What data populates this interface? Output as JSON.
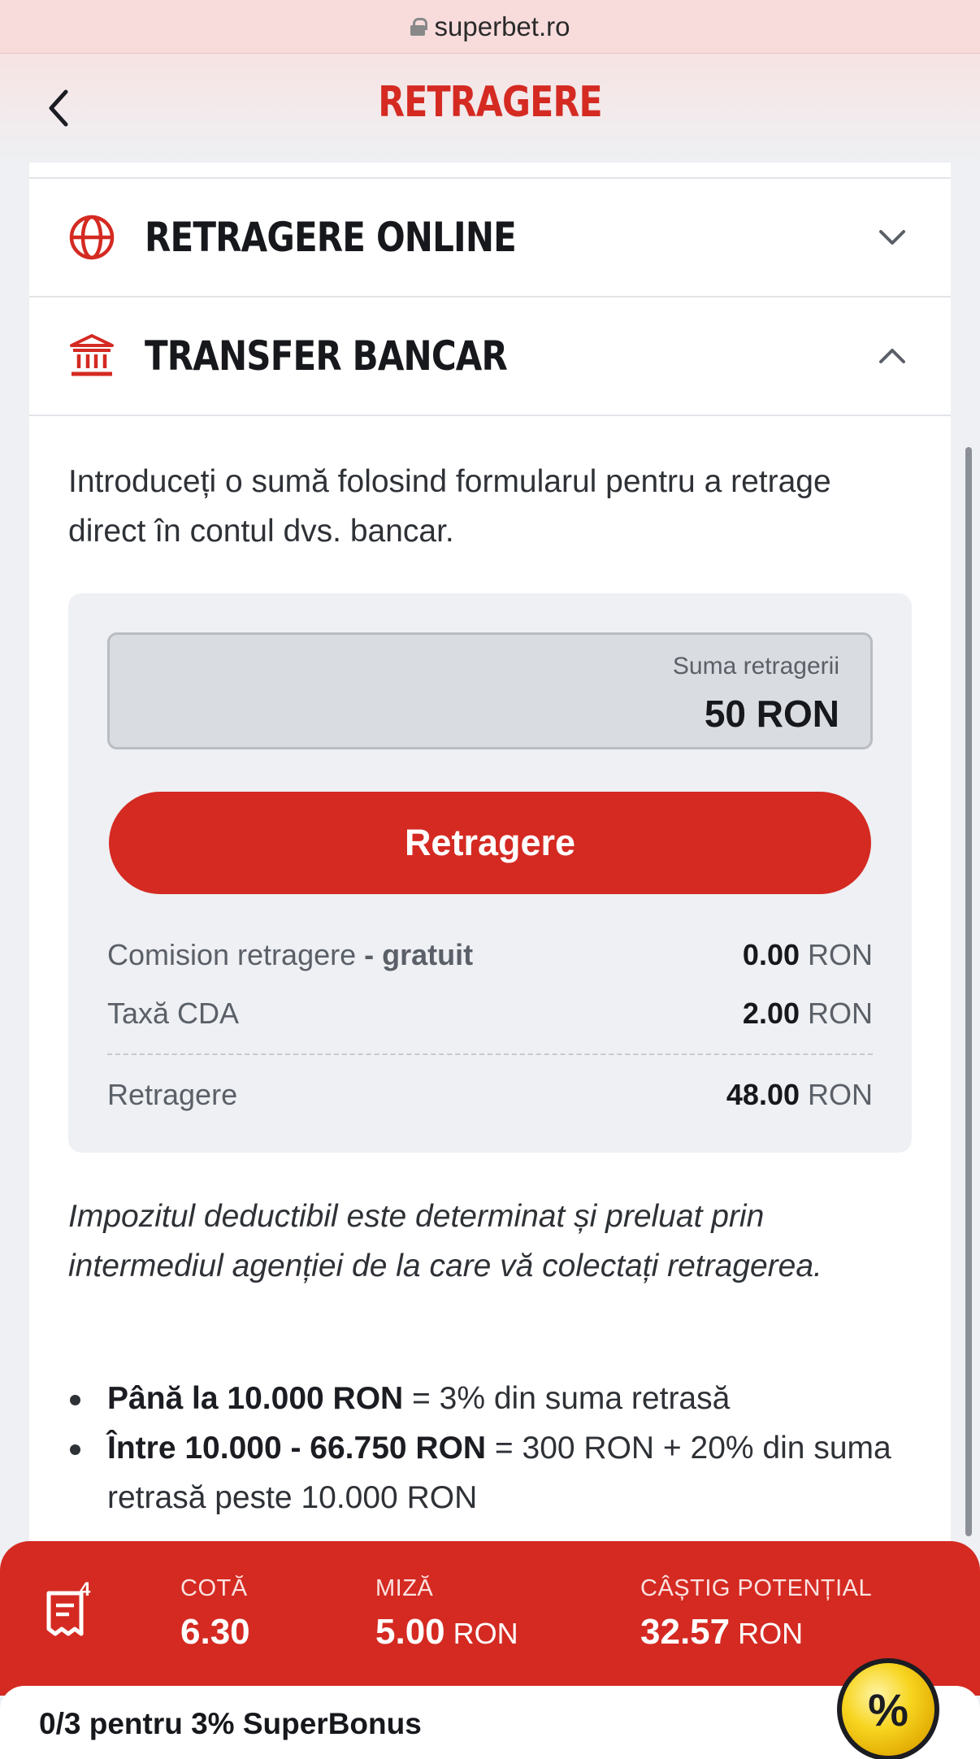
{
  "browser": {
    "url": "superbet.ro"
  },
  "header": {
    "title": "RETRAGERE"
  },
  "sections": {
    "online": {
      "label": "RETRAGERE ONLINE",
      "icon": "globe-icon",
      "expanded": false
    },
    "transfer": {
      "label": "TRANSFER BANCAR",
      "icon": "bank-icon",
      "expanded": true
    }
  },
  "intro": "Introduceți o sumă folosind formularul pentru a retrage direct în contul dvs. bancar.",
  "form": {
    "amount_label": "Suma retragerii",
    "amount_value": "50 RON",
    "submit_label": "Retragere",
    "fees": [
      {
        "label": "Comision retragere",
        "label_bold": " - gratuit",
        "value": "0.00",
        "unit": " RON"
      },
      {
        "label": "Taxă CDA",
        "value": "2.00",
        "unit": " RON"
      },
      {
        "label": "Retragere",
        "value": "48.00",
        "unit": " RON"
      }
    ]
  },
  "tax_note": "Impozitul deductibil este determinat și preluat prin intermediul agenției de la care vă colectați retragerea.",
  "tax_rules": [
    {
      "bold": "Până la 10.000 RON",
      "text": " = 3% din suma retrasă"
    },
    {
      "bold": "Între 10.000 - 66.750 RON",
      "text": " = 300 RON + 20% din suma retrasă peste 10.000 RON"
    }
  ],
  "betslip": {
    "count": "4",
    "odds_label": "COTĂ",
    "odds_value": "6.30",
    "stake_label": "MIZĂ",
    "stake_value": "5.00",
    "stake_unit": " RON",
    "win_label": "CÂȘTIG POTENȚIAL",
    "win_value": "32.57",
    "win_unit": " RON"
  },
  "bonus": {
    "text": "0/3 pentru 3% SuperBonus",
    "badge": "%"
  },
  "colors": {
    "brand": "#d42a22",
    "panel": "#eef0f3",
    "text": "#16181c"
  }
}
